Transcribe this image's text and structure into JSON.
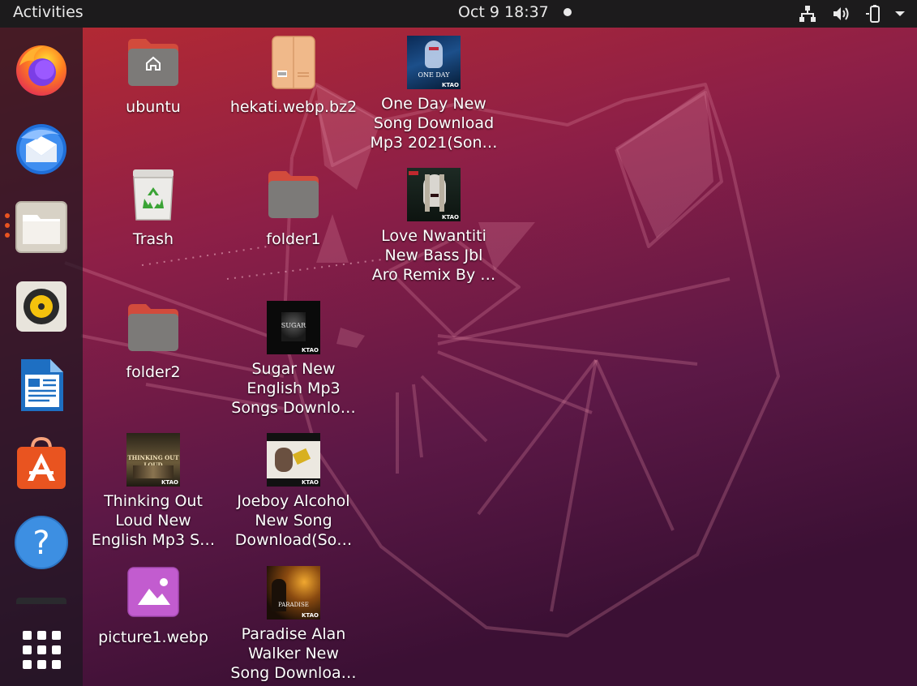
{
  "topbar": {
    "activities": "Activities",
    "clock": "Oct 9  18:37",
    "tray_icons": [
      "network-icon",
      "volume-icon",
      "battery-icon",
      "system-menu-chevron-icon"
    ]
  },
  "dock": {
    "items": [
      {
        "name": "Firefox Web Browser",
        "icon": "firefox-icon"
      },
      {
        "name": "Thunderbird Mail",
        "icon": "thunderbird-icon"
      },
      {
        "name": "Files",
        "icon": "files-icon",
        "running": true
      },
      {
        "name": "Rhythmbox",
        "icon": "rhythmbox-icon"
      },
      {
        "name": "LibreOffice Writer",
        "icon": "writer-icon"
      },
      {
        "name": "Ubuntu Software",
        "icon": "software-icon"
      },
      {
        "name": "Help",
        "icon": "help-icon"
      },
      {
        "name": "Show Applications",
        "icon": "show-apps-grid-icon"
      }
    ]
  },
  "desktop": {
    "items": [
      {
        "label": "ubuntu",
        "icon": "home-folder-icon"
      },
      {
        "label": "hekati.webp.bz2",
        "icon": "archive-icon"
      },
      {
        "label": "One Day New\nSong Download\nMp3 2021(Son…",
        "icon": "audio-thumbnail-icon",
        "thumb_title": "ONE DAY"
      },
      {
        "label": "Trash",
        "icon": "trash-icon"
      },
      {
        "label": "folder1",
        "icon": "folder-icon"
      },
      {
        "label": "Love Nwantiti\nNew Bass Jbl\nAro Remix By …",
        "icon": "audio-thumbnail-icon"
      },
      {
        "label": "folder2",
        "icon": "folder-icon"
      },
      {
        "label": "Sugar New\nEnglish Mp3\nSongs Downlo…",
        "icon": "audio-thumbnail-icon",
        "thumb_title": "SUGAR"
      },
      {
        "label": "Thinking Out\nLoud New\nEnglish Mp3 S…",
        "icon": "audio-thumbnail-icon",
        "thumb_title": "THINKING OUT LOUD"
      },
      {
        "label": "Joeboy Alcohol\nNew Song\nDownload(So…",
        "icon": "audio-thumbnail-icon"
      },
      {
        "label": "picture1.webp",
        "icon": "image-file-icon"
      },
      {
        "label": "Paradise Alan\nWalker New\nSong Downloa…",
        "icon": "audio-thumbnail-icon",
        "thumb_title": "PARADISE"
      }
    ],
    "thumb_brand": "KTAO"
  },
  "colors": {
    "topbar": "#1c1b1c",
    "accent": "#e95420",
    "wallpaper_top": "#b42d2d",
    "wallpaper_bottom": "#3c0f36"
  }
}
